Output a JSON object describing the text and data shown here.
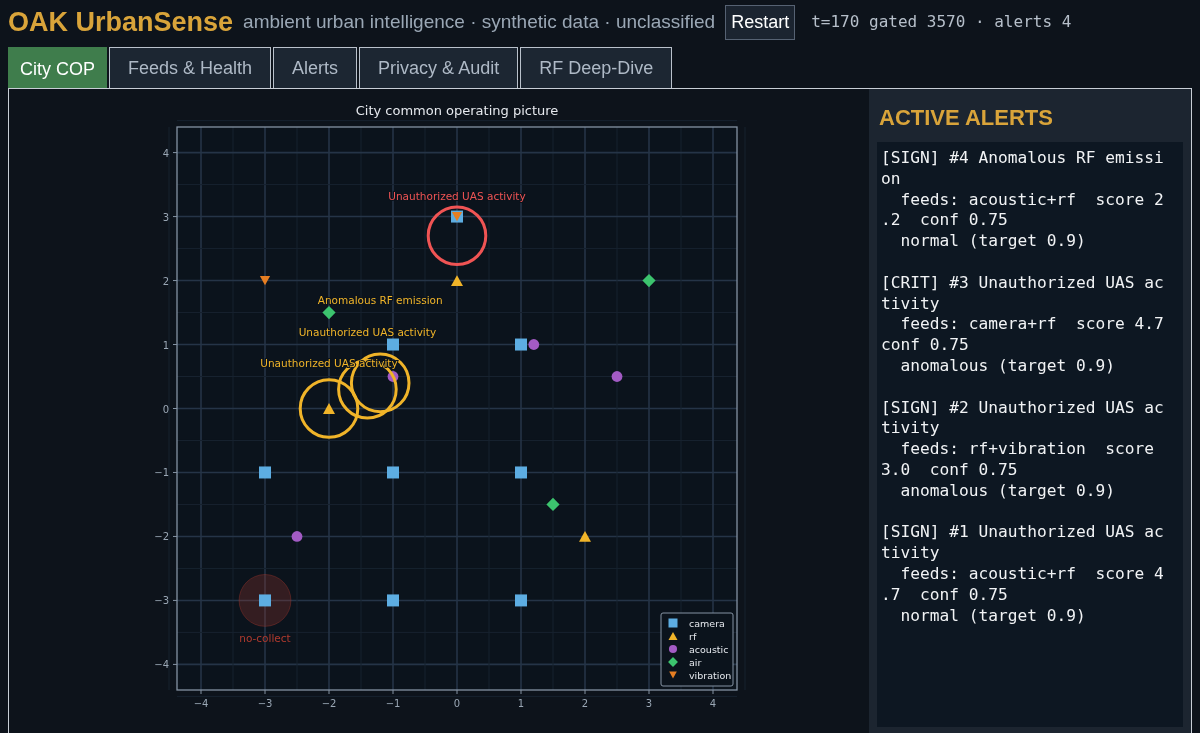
{
  "header": {
    "title": "OAK UrbanSense",
    "subtitle": "ambient urban intelligence · synthetic data · unclassified",
    "restart_button": "Restart",
    "status": "t=170  gated 3570 · alerts 4"
  },
  "tabs": [
    {
      "label": "City COP",
      "selected": true
    },
    {
      "label": "Feeds & Health",
      "selected": false
    },
    {
      "label": "Alerts",
      "selected": false
    },
    {
      "label": "Privacy & Audit",
      "selected": false
    },
    {
      "label": "RF Deep-Dive",
      "selected": false
    }
  ],
  "map": {
    "chart_data": {
      "type": "scatter",
      "title": "City common operating picture",
      "xlim": [
        -4.375,
        4.375
      ],
      "ylim": [
        -4.4,
        4.4
      ],
      "xticks": [
        {
          "value": -4,
          "label": "−4"
        },
        {
          "value": -3,
          "label": "−3"
        },
        {
          "value": -2,
          "label": "−2"
        },
        {
          "value": -1,
          "label": "−1"
        },
        0,
        1,
        2,
        3,
        4
      ],
      "yticks": [
        {
          "value": -4,
          "label": "−4"
        },
        {
          "value": -3,
          "label": "−3"
        },
        {
          "value": -2,
          "label": "−2"
        },
        {
          "value": -1,
          "label": "−1"
        },
        0,
        1,
        2,
        3,
        4
      ],
      "series": [
        {
          "name": "camera",
          "color": "#5dade2",
          "x": [
            -3,
            -1,
            1,
            -3,
            -1,
            1,
            -1,
            1,
            0
          ],
          "values": [
            -1,
            -1,
            -1,
            -3,
            -3,
            -3,
            1,
            1,
            3
          ]
        },
        {
          "name": "rf",
          "color": "#f0b429",
          "x": [
            0,
            -2,
            2
          ],
          "values": [
            2,
            0,
            -2
          ]
        },
        {
          "name": "acoustic",
          "color": "#a35bc4",
          "x": [
            1.2,
            2.5,
            -1,
            -2.5
          ],
          "values": [
            1,
            0.5,
            0.5,
            -2
          ]
        },
        {
          "name": "air",
          "color": "#3cc46e",
          "x": [
            -2,
            3,
            1.5
          ],
          "values": [
            1.5,
            2,
            -1.5
          ]
        },
        {
          "name": "vibration",
          "color": "#e67e22",
          "x": [
            -3,
            0
          ],
          "values": [
            2,
            3
          ]
        }
      ],
      "grid": true,
      "legend": "lower right",
      "annotations": [
        "no-collect",
        "Unauthorized UAS activity",
        "Unauthorized UAS activity",
        "Unauthorized UAS activity",
        "Anomalous RF emission"
      ]
    },
    "series_markers": [
      {
        "kind": "square"
      },
      {
        "kind": "triangle"
      },
      {
        "kind": "circle"
      },
      {
        "kind": "diamond"
      },
      {
        "kind": "down-triangle"
      }
    ],
    "overlays": [
      {
        "kind": "no-collect",
        "color": "#b03a2e"
      },
      {
        "kind": "alert-ring",
        "color": "#f05454"
      },
      {
        "kind": "alert-ring",
        "color": "#f0b429"
      },
      {
        "kind": "alert-ring",
        "color": "#f0b429"
      },
      {
        "kind": "alert-ring",
        "color": "#f0b429"
      }
    ]
  },
  "alerts_panel": {
    "heading": "ACTIVE ALERTS",
    "alerts": [
      {
        "headline": "[SIGN] #4 Anomalous RF emission",
        "detail": "  feeds: acoustic+rf  score 2.2  conf 0.75",
        "status": "  normal (target 0.9)"
      },
      {
        "headline": "[CRIT] #3 Unauthorized UAS activity",
        "detail": "  feeds: camera+rf  score 4.7 conf 0.75",
        "status": "  anomalous (target 0.9)"
      },
      {
        "headline": "[SIGN] #2 Unauthorized UAS activity",
        "detail": "  feeds: rf+vibration  score 3.0  conf 0.75",
        "status": "  anomalous (target 0.9)"
      },
      {
        "headline": "[SIGN] #1 Unauthorized UAS activity",
        "detail": "  feeds: acoustic+rf  score 4.7  conf 0.75",
        "status": "  normal (target 0.9)"
      }
    ]
  }
}
